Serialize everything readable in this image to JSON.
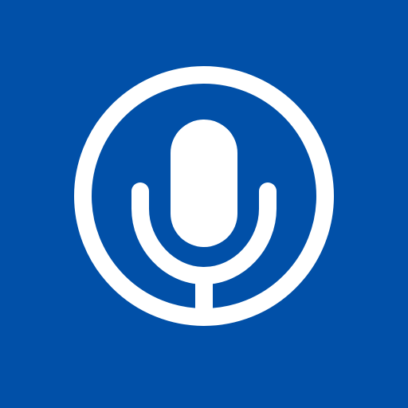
{
  "app_icon": {
    "icon": "microphone-icon",
    "colors": {
      "background": "#0150A8",
      "foreground": "#FFFFFF"
    }
  }
}
